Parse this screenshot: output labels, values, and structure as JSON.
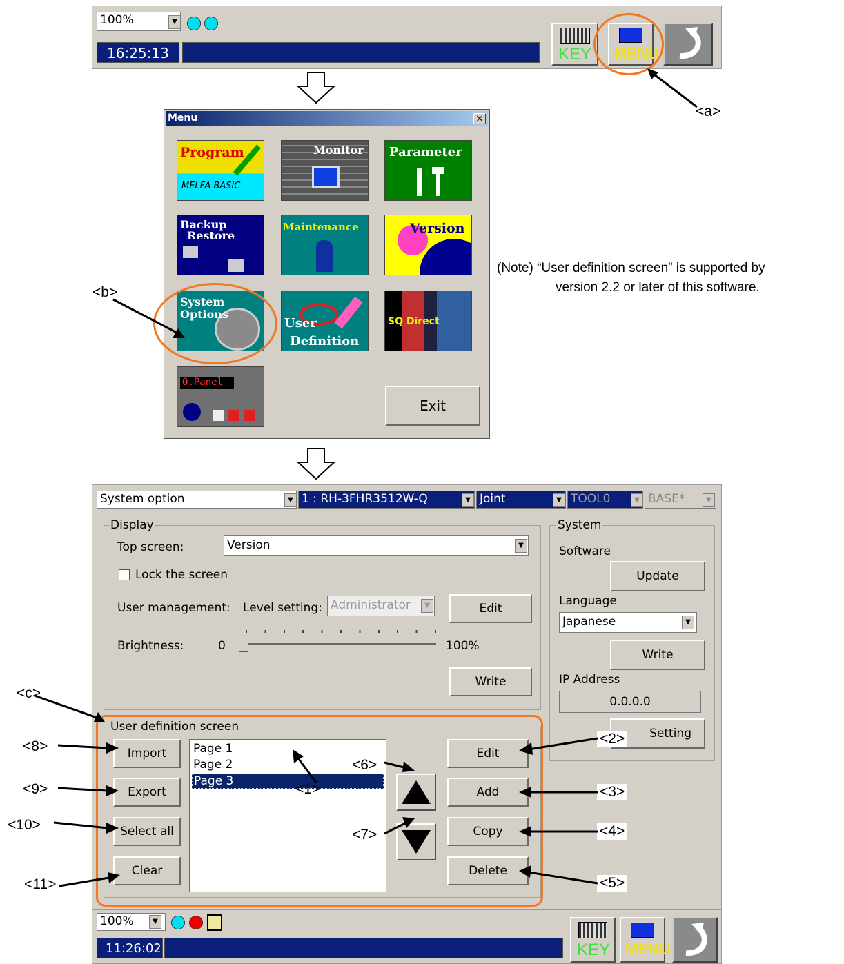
{
  "top_bar": {
    "zoom": "100%",
    "time": "16:25:13",
    "key_label": "KEY",
    "menu_label": "MENU"
  },
  "menu_window": {
    "title": "Menu",
    "close": "×",
    "tiles": {
      "program": "Program",
      "program_sub": "MELFA BASIC",
      "monitor": "Monitor",
      "parameter": "Parameter",
      "backup_line1": "Backup",
      "backup_line2": "Restore",
      "maintenance": "Maintenance",
      "version": "Version",
      "system_line1": "System",
      "system_line2": "Options",
      "user_line1": "User",
      "user_line2": "Definition",
      "sq_direct": "SQ Direct",
      "opanel": "O.Panel"
    },
    "exit_label": "Exit"
  },
  "note": {
    "line1": "(Note) “User definition screen” is supported by",
    "line2": "version 2.2 or later of this software."
  },
  "callouts": {
    "a": "<a>",
    "b": "<b>",
    "c": "<c>",
    "n1": "<1>",
    "n2": "<2>",
    "n3": "<3>",
    "n4": "<4>",
    "n5": "<5>",
    "n6": "<6>",
    "n7": "<7>",
    "n8": "<8>",
    "n9": "<9>",
    "n10": "<10>",
    "n11": "<11>"
  },
  "system_option": {
    "header": {
      "screen_select": "System option",
      "robot_select": "1 : RH-3FHR3512W-Q",
      "jog_select": "Joint",
      "tool_select": "TOOL0",
      "base_select": "BASE*"
    },
    "display": {
      "legend": "Display",
      "top_screen_label": "Top screen:",
      "top_screen_value": "Version",
      "lock_label": "Lock the screen",
      "user_mgmt_label": "User management:",
      "level_label": "Level setting:",
      "level_value": "Administrator",
      "edit_label": "Edit",
      "brightness_label": "Brightness:",
      "brightness_min": "0",
      "brightness_max": "100%",
      "brightness_value": 0,
      "write_label": "Write"
    },
    "system": {
      "legend": "System",
      "software_label": "Software",
      "update_label": "Update",
      "language_label": "Language",
      "language_value": "Japanese",
      "write_label": "Write",
      "ip_label": "IP Address",
      "ip_value": "0.0.0.0",
      "setting_label": "Setting"
    },
    "user_def": {
      "legend": "User definition screen",
      "import_label": "Import",
      "export_label": "Export",
      "select_all_label": "Select all",
      "clear_label": "Clear",
      "pages": [
        "Page 1",
        "Page 2",
        "Page 3"
      ],
      "selected_page": "Page 3",
      "edit_label": "Edit",
      "add_label": "Add",
      "copy_label": "Copy",
      "delete_label": "Delete"
    }
  },
  "bottom_bar": {
    "zoom": "100%",
    "time": "11:26:02",
    "key_label": "KEY",
    "menu_label": "MENU"
  },
  "colors": {
    "panel": "#d4d0c8",
    "navy": "#0a1f7a",
    "highlight_orange": "#f07820"
  }
}
